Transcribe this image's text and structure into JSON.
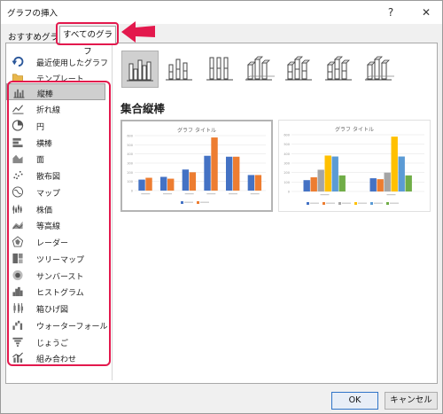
{
  "window": {
    "title": "グラフの挿入",
    "help_glyph": "?",
    "close_glyph": "✕"
  },
  "tabs": {
    "recommended": "おすすめグラフ",
    "all_charts": "すべてのグラフ"
  },
  "sidebar": {
    "items": [
      {
        "label": "最近使用したグラフ",
        "icon": "undo-icon"
      },
      {
        "label": "テンプレート",
        "icon": "folder-icon"
      },
      {
        "label": "縦棒",
        "icon": "column-chart-icon",
        "selected": true
      },
      {
        "label": "折れ線",
        "icon": "line-chart-icon"
      },
      {
        "label": "円",
        "icon": "pie-chart-icon"
      },
      {
        "label": "横棒",
        "icon": "bar-chart-icon"
      },
      {
        "label": "面",
        "icon": "area-chart-icon"
      },
      {
        "label": "散布図",
        "icon": "scatter-chart-icon"
      },
      {
        "label": "マップ",
        "icon": "map-chart-icon"
      },
      {
        "label": "株価",
        "icon": "stock-chart-icon"
      },
      {
        "label": "等高線",
        "icon": "surface-chart-icon"
      },
      {
        "label": "レーダー",
        "icon": "radar-chart-icon"
      },
      {
        "label": "ツリーマップ",
        "icon": "treemap-chart-icon"
      },
      {
        "label": "サンバースト",
        "icon": "sunburst-chart-icon"
      },
      {
        "label": "ヒストグラム",
        "icon": "histogram-chart-icon"
      },
      {
        "label": "箱ひげ図",
        "icon": "boxwhisker-chart-icon"
      },
      {
        "label": "ウォーターフォール",
        "icon": "waterfall-chart-icon"
      },
      {
        "label": "じょうご",
        "icon": "funnel-chart-icon"
      },
      {
        "label": "組み合わせ",
        "icon": "combo-chart-icon"
      }
    ]
  },
  "main": {
    "section_title": "集合縦棒",
    "subtypes": [
      {
        "icon": "clustered-column-icon",
        "selected": true
      },
      {
        "icon": "stacked-column-icon"
      },
      {
        "icon": "100-stacked-column-icon"
      },
      {
        "icon": "3d-clustered-column-icon"
      },
      {
        "icon": "3d-stacked-column-icon"
      },
      {
        "icon": "3d-100-stacked-column-icon"
      },
      {
        "icon": "3d-column-icon"
      }
    ]
  },
  "previews": [
    {
      "title": "グラフ タイトル",
      "chart_data": {
        "type": "bar",
        "categories": [
          "",
          "",
          "",
          "",
          "",
          ""
        ],
        "series": [
          {
            "values": [
              120,
              150,
              230,
              380,
              370,
              170
            ]
          },
          {
            "values": [
              140,
              130,
              200,
              580,
              370,
              170
            ]
          }
        ],
        "ylim": [
          0,
          600
        ]
      }
    },
    {
      "title": "グラフ タイトル",
      "chart_data": {
        "type": "bar",
        "categories": [
          "",
          ""
        ],
        "series": [
          {
            "values": [
              120,
              140
            ]
          },
          {
            "values": [
              150,
              130
            ]
          },
          {
            "values": [
              230,
              200
            ]
          },
          {
            "values": [
              380,
              580
            ]
          },
          {
            "values": [
              370,
              370
            ]
          },
          {
            "values": [
              170,
              170
            ]
          }
        ],
        "ylim": [
          0,
          600
        ]
      }
    }
  ],
  "colors": {
    "blue": "#4472c4",
    "orange": "#ed7d31",
    "gray": "#a5a5a5",
    "yellow": "#ffc000",
    "lightblue": "#5b9bd5",
    "green": "#70ad47",
    "highlight": "#e3194d",
    "arrow": "#e3194d"
  },
  "buttons": {
    "ok": "OK",
    "cancel": "キャンセル"
  }
}
